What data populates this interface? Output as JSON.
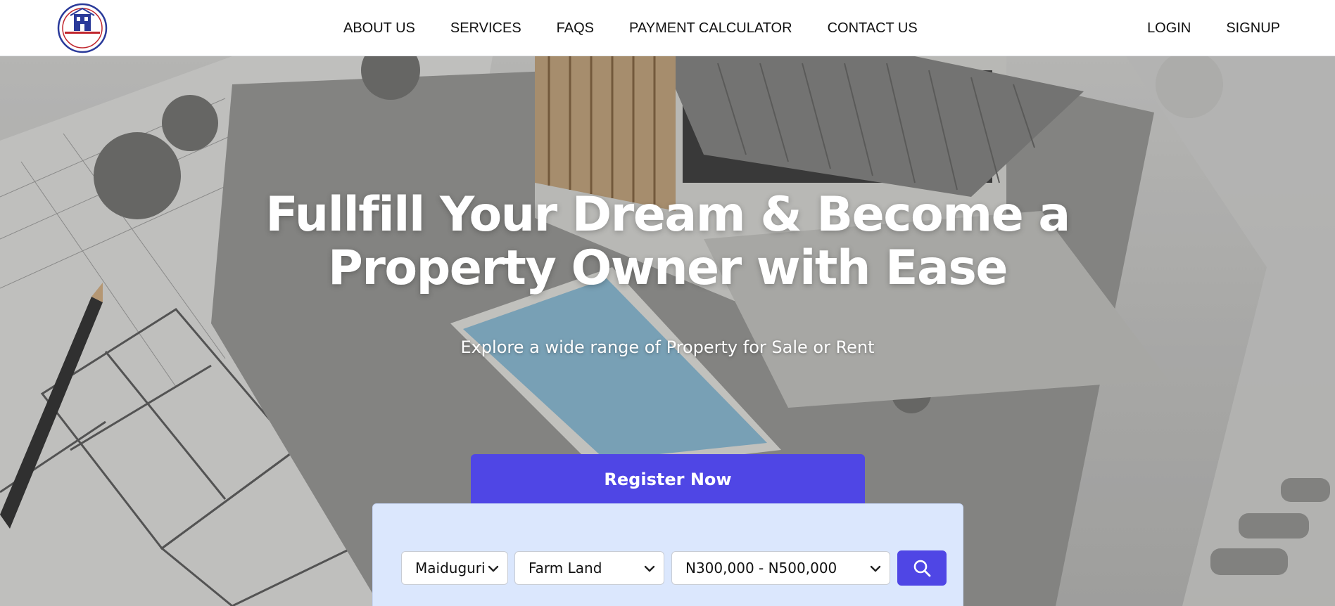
{
  "brand": {
    "logo_text": "A.A BEST LAND VENDORS LIMITED",
    "logo_sub": "RC 7385056",
    "accent_color": "#4f46e5"
  },
  "nav": {
    "links": [
      "ABOUT US",
      "SERVICES",
      "FAQS",
      "PAYMENT CALCULATOR",
      "CONTACT US"
    ],
    "auth": [
      "LOGIN",
      "SIGNUP"
    ]
  },
  "hero": {
    "headline_line1": "Fullfill Your Dream & Become a",
    "headline_line2": "Property Owner with Ease",
    "subheadline": "Explore a wide range of Property for Sale or Rent",
    "register_label": "Register Now"
  },
  "search": {
    "city": "Maiduguri",
    "property_type": "Farm Land",
    "price_range": "N300,000 - N500,000",
    "button_icon": "search-icon"
  }
}
